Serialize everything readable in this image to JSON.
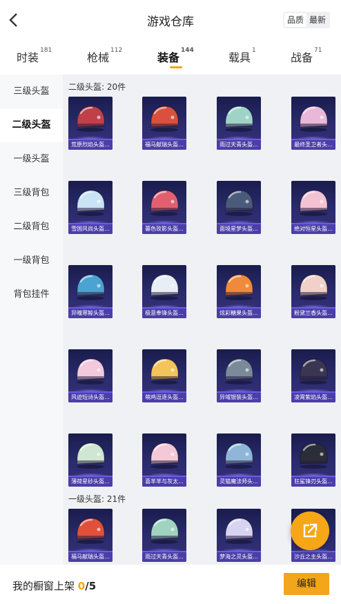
{
  "header": {
    "title": "游戏仓库",
    "sort_quality": "品质",
    "sort_latest": "最新"
  },
  "tabs": [
    {
      "label": "时装",
      "count": "181"
    },
    {
      "label": "枪械",
      "count": "112"
    },
    {
      "label": "装备",
      "count": "144"
    },
    {
      "label": "载具",
      "count": "1"
    },
    {
      "label": "战备",
      "count": "71"
    }
  ],
  "sidebar": [
    "三级头盔",
    "二级头盔",
    "一级头盔",
    "三级背包",
    "二级背包",
    "一级背包",
    "背包挂件"
  ],
  "sections": [
    {
      "title": "二级头盔: 20件",
      "items": [
        {
          "name": "荒原烈焰头盔...",
          "icon": "helmet-red-horned",
          "color": "#c0404a"
        },
        {
          "name": "福马献瑞头盔...",
          "icon": "helmet-red-green",
          "color": "#d9503c"
        },
        {
          "name": "雨过天青头盔...",
          "icon": "helmet-mint",
          "color": "#9fd3c7"
        },
        {
          "name": "最终圣卫者头...",
          "icon": "helmet-pink-cat",
          "color": "#e9b8d8"
        },
        {
          "name": "雪国风尚头盔...",
          "icon": "helmet-icy-blue",
          "color": "#c9e3f5"
        },
        {
          "name": "暮色玫影头盔...",
          "icon": "helmet-red-white",
          "color": "#e06070"
        },
        {
          "name": "面境星梦头盔...",
          "icon": "helmet-dark-star",
          "color": "#4a5a7a"
        },
        {
          "name": "绝对恒星头盔...",
          "icon": "helmet-pink-white",
          "color": "#f3c3d3"
        },
        {
          "name": "异曈寒鲸头盔...",
          "icon": "helmet-blue-shark",
          "color": "#4aa3d0"
        },
        {
          "name": "极意奉锋头盔...",
          "icon": "helmet-white-crown",
          "color": "#e8eef5"
        },
        {
          "name": "炫彩糖果头盔...",
          "icon": "helmet-orange-pink",
          "color": "#f08a3a"
        },
        {
          "name": "粉黛兰香头盔...",
          "icon": "helmet-cream",
          "color": "#f0d0c8"
        },
        {
          "name": "风迹短诗头盔...",
          "icon": "helmet-pink-light",
          "color": "#f3c9dd"
        },
        {
          "name": "萌鸡逗逐头盔...",
          "icon": "helmet-yellow",
          "color": "#f2c45a"
        },
        {
          "name": "异域银装头盔...",
          "icon": "helmet-silver-dark",
          "color": "#7a8a9a"
        },
        {
          "name": "凌霄紫焰头盔...",
          "icon": "helmet-black-purple",
          "color": "#3a3550"
        },
        {
          "name": "薄荷星砂头盔...",
          "icon": "helmet-mint-light",
          "color": "#cfe6d3"
        },
        {
          "name": "喜羊羊与灰太...",
          "icon": "helmet-pink-sheep",
          "color": "#f4c8d6"
        },
        {
          "name": "灵猫魔法师头...",
          "icon": "helmet-blue-cat",
          "color": "#8fb6d8"
        },
        {
          "name": "狂鲨锋刃头盔...",
          "icon": "helmet-black-shark",
          "color": "#2b2e38"
        }
      ]
    },
    {
      "title": "一级头盔: 21件",
      "items": [
        {
          "name": "福马献瑞头盔...",
          "icon": "helmet-red-visor",
          "color": "#e0503a"
        },
        {
          "name": "雨过天青头盔...",
          "icon": "helmet-green-visor",
          "color": "#9fd3c0"
        },
        {
          "name": "梦海之灵头盔...",
          "icon": "helmet-lavender",
          "color": "#d8d3f0"
        },
        {
          "name": "沙丘之主头盔...",
          "icon": "helmet-tan",
          "color": "#d8b070"
        }
      ]
    }
  ],
  "bottom": {
    "label": "我的橱窗上架 ",
    "current": "0",
    "total": "/5",
    "edit": "编辑"
  },
  "colors": {
    "accent": "#f3a51b",
    "card_bg": "#2a2c6e",
    "card_label": "#4b3ea8"
  }
}
